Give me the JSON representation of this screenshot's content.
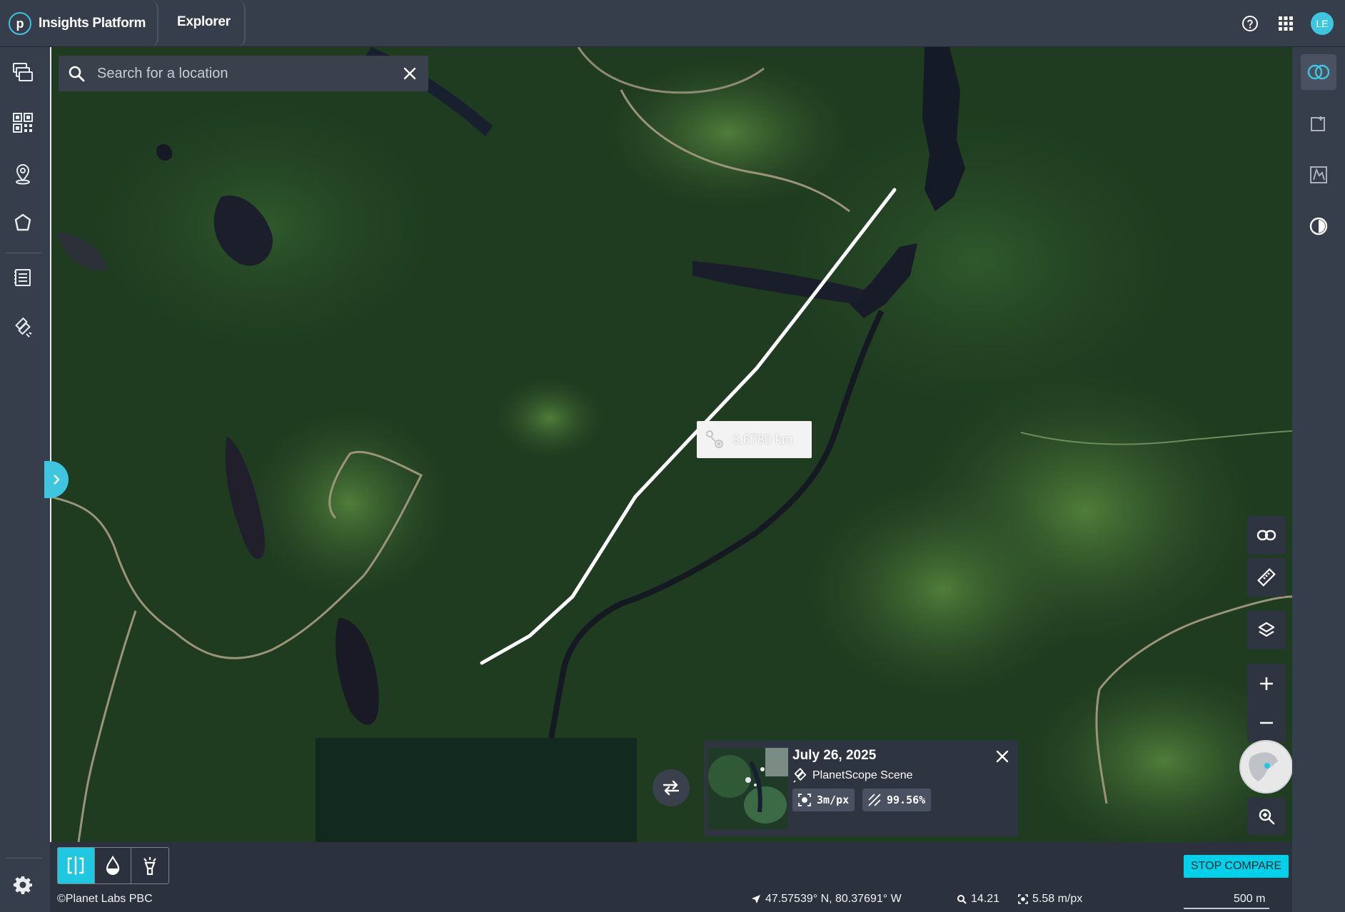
{
  "app": {
    "title": "Insights Platform",
    "logo_letter": "p",
    "active_tab": "Explorer",
    "user_initials": "LE",
    "accent_color": "#3ec6e0"
  },
  "topbar_icons": [
    "help-icon",
    "apps-grid-icon"
  ],
  "left_sidebar": {
    "items": [
      "feed-icon",
      "mosaic-icon",
      "place-pin-icon",
      "polygon-icon",
      "report-icon",
      "satellite-tasking-icon"
    ],
    "footer": "settings-gear-icon"
  },
  "right_sidebar": {
    "items": [
      "compare-rings-icon",
      "add-image-icon",
      "elevation-profile-icon",
      "contrast-icon"
    ]
  },
  "search": {
    "placeholder": "Search for a location",
    "value": ""
  },
  "measurement": {
    "distance": "3.6780 km"
  },
  "map_controls": [
    "share-link-icon",
    "ruler-icon",
    "layers-icon",
    "zoom-in-icon",
    "zoom-out-icon",
    "globe-minimap",
    "zoom-to-icon"
  ],
  "scene": {
    "date": "July 26, 2025",
    "type": "PlanetScope Scene",
    "resolution": "3m/px",
    "coverage": "99.56%"
  },
  "bottom_bar": {
    "modes": [
      "split-compare-icon",
      "drop-icon",
      "spotlight-icon"
    ],
    "active_mode": "split-compare-icon",
    "stop_compare_label": "STOP COMPARE"
  },
  "status": {
    "attribution": "©Planet Labs PBC",
    "coordinates": "47.57539° N, 80.37691° W",
    "zoom": "14.21",
    "resolution": "5.58 m/px",
    "scale": "500 m"
  }
}
